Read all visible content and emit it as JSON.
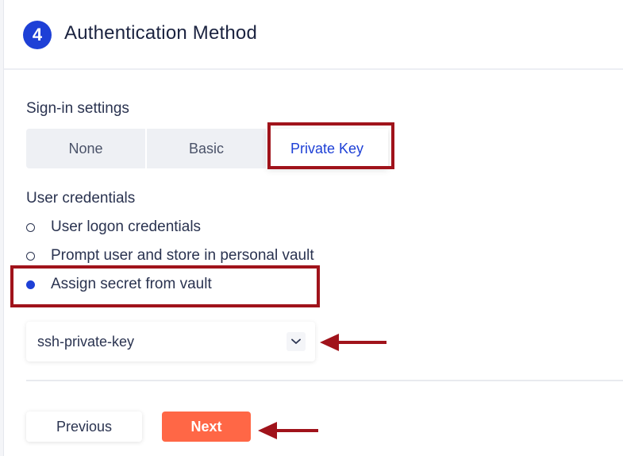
{
  "header": {
    "step_number": "4",
    "title": "Authentication Method"
  },
  "sign_in": {
    "label": "Sign-in settings",
    "options": [
      "None",
      "Basic",
      "Private Key"
    ],
    "selected": "Private Key"
  },
  "credentials": {
    "label": "User credentials",
    "options": [
      {
        "label": "User logon credentials",
        "checked": false
      },
      {
        "label": "Prompt user and store in personal vault",
        "checked": false
      },
      {
        "label": "Assign secret from vault",
        "checked": true
      }
    ]
  },
  "secret_select": {
    "value": "ssh-private-key",
    "icon": "chevron-down-icon"
  },
  "footer": {
    "previous_label": "Previous",
    "next_label": "Next"
  },
  "colors": {
    "accent": "#1e40d6",
    "next_button": "#ff6746",
    "annotation": "#a0131b"
  }
}
